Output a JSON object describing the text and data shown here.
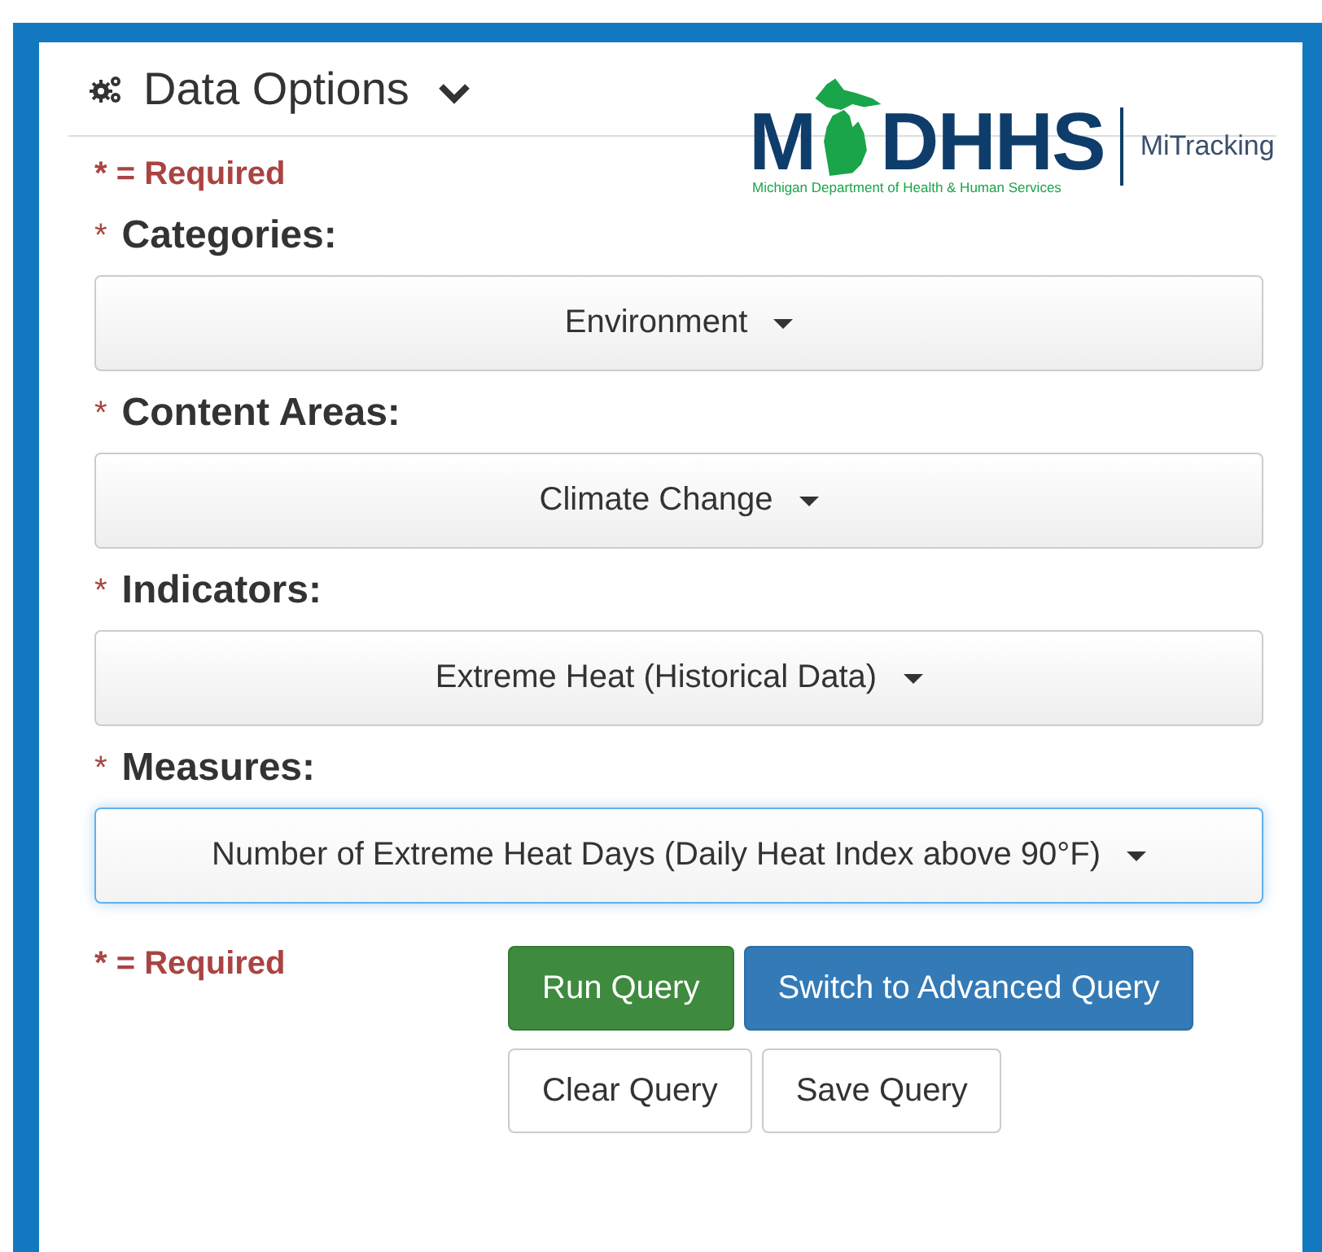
{
  "panel": {
    "title": "Data Options",
    "expanded": true
  },
  "logo": {
    "left": "M",
    "right": "DHHS",
    "subtitle": "Michigan Department of Health & Human Services",
    "product": "MiTracking"
  },
  "required_note_top": {
    "text": "* = Required"
  },
  "fields": [
    {
      "label": "Categories:",
      "required_mark": "*",
      "value": "Environment",
      "focused": false
    },
    {
      "label": "Content Areas:",
      "required_mark": "*",
      "value": "Climate Change",
      "focused": false
    },
    {
      "label": "Indicators:",
      "required_mark": "*",
      "value": "Extreme Heat (Historical Data)",
      "focused": false
    },
    {
      "label": "Measures:",
      "required_mark": "*",
      "value": "Number of Extreme Heat Days (Daily Heat Index above 90°F)",
      "focused": true
    }
  ],
  "required_note_bottom": {
    "text": "* = Required"
  },
  "buttons": [
    {
      "label": "Run Query",
      "kind": "success"
    },
    {
      "label": "Switch to Advanced Query",
      "kind": "primary"
    },
    {
      "label": "Clear Query",
      "kind": "default"
    },
    {
      "label": "Save Query",
      "kind": "default"
    }
  ]
}
